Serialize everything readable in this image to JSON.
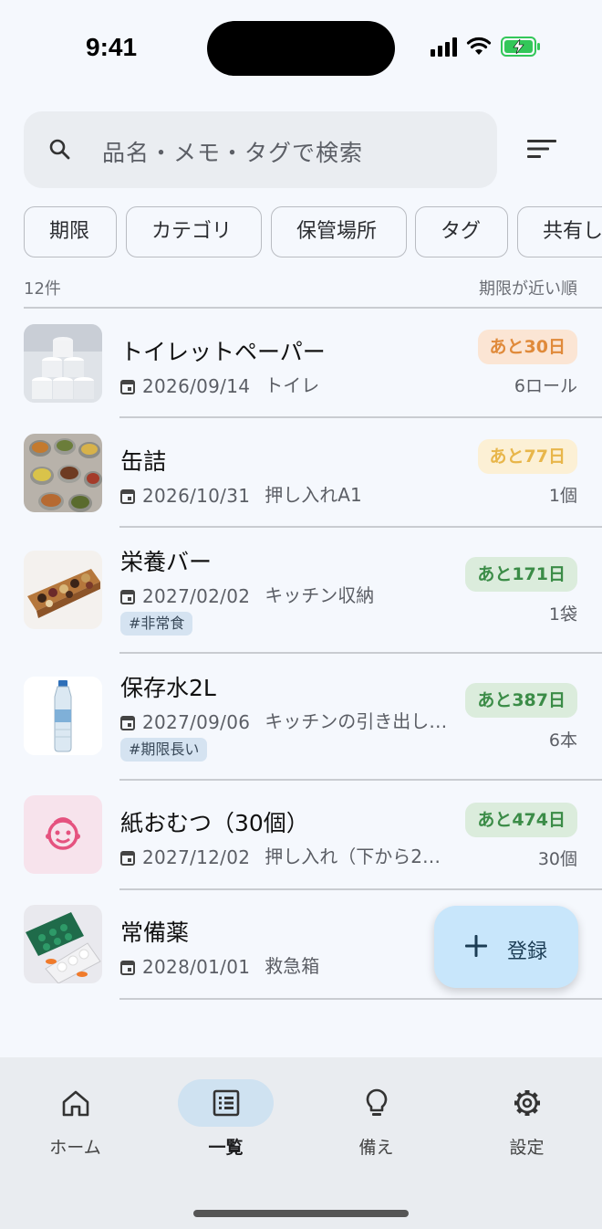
{
  "status_bar": {
    "time": "9:41"
  },
  "search": {
    "placeholder": "品名・メモ・タグで検索"
  },
  "filters": [
    "期限",
    "カテゴリ",
    "保管場所",
    "タグ",
    "共有し"
  ],
  "list_meta": {
    "count": "12件",
    "sort": "期限が近い順"
  },
  "items": [
    {
      "name": "トイレットペーパー",
      "date": "2026/09/14",
      "location": "トイレ",
      "tag": "",
      "badge": "あと30日",
      "badge_color": "#e08a3a",
      "quantity": "6ロール",
      "thumb_icon": "toilet-paper-image"
    },
    {
      "name": "缶詰",
      "date": "2026/10/31",
      "location": "押し入れA1",
      "tag": "",
      "badge": "あと77日",
      "badge_color": "#e8b64a",
      "quantity": "1個",
      "thumb_icon": "canned-food-image"
    },
    {
      "name": "栄養バー",
      "date": "2027/02/02",
      "location": "キッチン収納",
      "tag": "#非常食",
      "badge": "あと171日",
      "badge_color": "#3b8c47",
      "quantity": "1袋",
      "thumb_icon": "nutrition-bar-image"
    },
    {
      "name": "保存水2L",
      "date": "2027/09/06",
      "location": "キッチンの引き出し…",
      "tag": "#期限長い",
      "badge": "あと387日",
      "badge_color": "#3b8c47",
      "quantity": "6本",
      "thumb_icon": "water-bottle-image"
    },
    {
      "name": "紙おむつ（30個）",
      "date": "2027/12/02",
      "location": "押し入れ（下から2…",
      "tag": "",
      "badge": "あと474日",
      "badge_color": "#3b8c47",
      "quantity": "30個",
      "thumb_icon": "baby-face-icon"
    },
    {
      "name": "常備薬",
      "date": "2028/01/01",
      "location": "救急箱",
      "tag": "",
      "badge": "",
      "badge_color": "",
      "quantity": "",
      "thumb_icon": "medicine-image"
    }
  ],
  "fab": {
    "label": "登録"
  },
  "nav": [
    {
      "label": "ホーム",
      "icon": "home-icon",
      "active": false
    },
    {
      "label": "一覧",
      "icon": "list-icon",
      "active": true
    },
    {
      "label": "備え",
      "icon": "lightbulb-icon",
      "active": false
    },
    {
      "label": "設定",
      "icon": "gear-icon",
      "active": false
    }
  ]
}
